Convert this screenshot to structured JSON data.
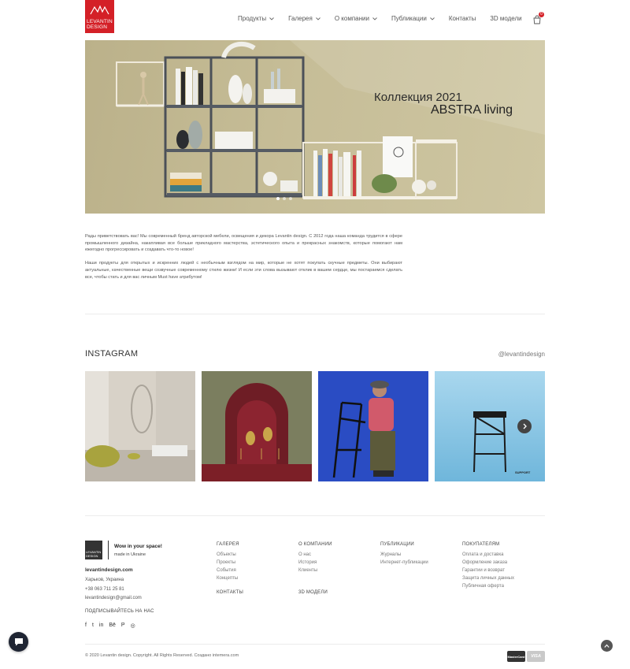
{
  "header": {
    "logo_line1": "LEVANTIN",
    "logo_line2": "DESIGN",
    "nav": [
      {
        "label": "Продукты",
        "has_dropdown": true
      },
      {
        "label": "Галерея",
        "has_dropdown": true
      },
      {
        "label": "О компании",
        "has_dropdown": true
      },
      {
        "label": "Публикации",
        "has_dropdown": true
      },
      {
        "label": "Контакты",
        "has_dropdown": false
      },
      {
        "label": "3D модели",
        "has_dropdown": false
      }
    ],
    "cart_count": "0",
    "brand_color": "#d42027"
  },
  "hero": {
    "title1": "Коллекция 2021",
    "title2": "ABSTRA living",
    "slide_count": 3,
    "active_slide": 1
  },
  "intro": {
    "p1": "Рады приветствовать вас! Мы современный бренд авторской мебели, освещения и декора Levantin design. С 2012 года наша команда трудится в сфере промышленного дизайна, накапливая все больше прикладного мастерства, эстетического опыта и прекрасных знакомств, которые помогают нам ежегодно прогрессировать и создавать что-то новое!",
    "p2": "Наши продукты для открытых и искренних людей с необычным взглядом на мир, которые не хотят покупать скучные предметы. Они выбирают актуальные, качественные вещи созвучные современному стилю жизни! И если эти слова вызывают отклик в вашем сердце, мы постараемся сделать все, чтобы стать и для вас личным Must have атрибутом!"
  },
  "instagram": {
    "title": "INSTAGRAM",
    "handle": "@levantindesign",
    "tile4_caption": "SUPPORT"
  },
  "footer": {
    "logo_line1": "LEVANTIN",
    "logo_line2": "DESIGN",
    "tagline": "Wow in your space!",
    "made_in": "made in Ukraine",
    "site": "levantindesign.com",
    "city": "Харьков, Украина",
    "phone": "+38 063 711 25 81",
    "email": "levantindesign@gmail.com",
    "subscribe": "ПОДПИСЫВАЙТЕСЬ НА НАС",
    "socials": [
      "f",
      "t",
      "in",
      "Bē",
      "P",
      "◎"
    ],
    "col_gallery": {
      "title": "ГАЛЕРЕЯ",
      "links": [
        "Объекты",
        "Проекты",
        "События",
        "Концепты"
      ]
    },
    "col_contacts": "КОНТАКТЫ",
    "col_about": {
      "title": "О КОМПАНИИ",
      "links": [
        "О нас",
        "История",
        "Клиенты"
      ]
    },
    "col_3d": "3D МОДЕЛИ",
    "col_pubs": {
      "title": "ПУБЛИКАЦИИ",
      "links": [
        "Журналы",
        "Интернет-публикации"
      ]
    },
    "col_buyers": {
      "title": "ПОКУПАТЕЛЯМ",
      "links": [
        "Оплата и доставка",
        "Оформление заказа",
        "Гарантии и возврат",
        "Защита личных данных",
        "Публичная оферта"
      ]
    },
    "copyright": "© 2020 Levantin design. Copyright. All Rights Reserved. Создано intemera.com",
    "cards": [
      "MasterCard",
      "VISA"
    ]
  }
}
